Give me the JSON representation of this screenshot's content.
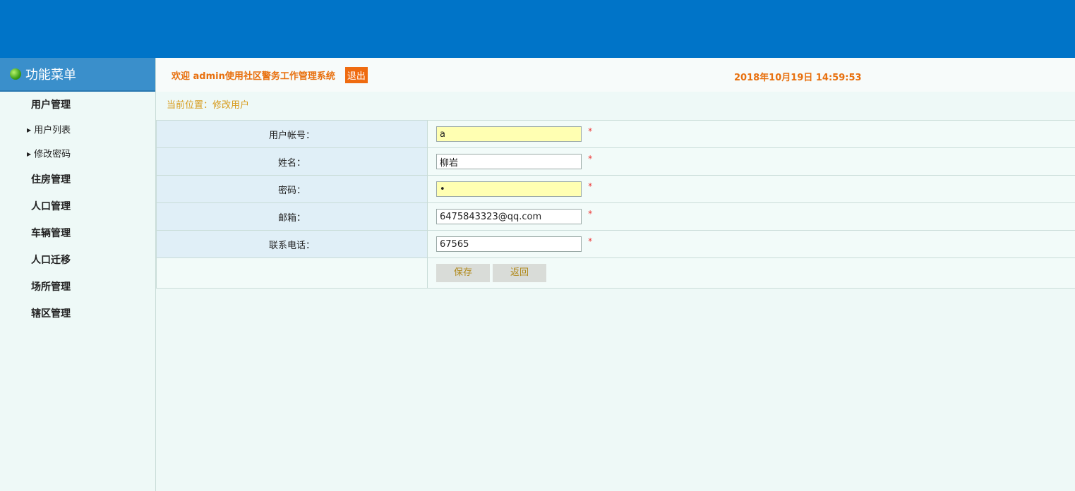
{
  "sidebar": {
    "title": "功能菜单",
    "items": [
      {
        "label": "用户管理",
        "type": "group"
      },
      {
        "label": "用户列表",
        "type": "sub"
      },
      {
        "label": "修改密码",
        "type": "sub"
      },
      {
        "label": "住房管理",
        "type": "group"
      },
      {
        "label": "人口管理",
        "type": "group"
      },
      {
        "label": "车辆管理",
        "type": "group"
      },
      {
        "label": "人口迁移",
        "type": "group"
      },
      {
        "label": "场所管理",
        "type": "group"
      },
      {
        "label": "辖区管理",
        "type": "group"
      }
    ]
  },
  "header": {
    "welcome": "欢迎 admin使用社区警务工作管理系统",
    "logout_label": "退出",
    "datetime": "2018年10月19日 14:59:53"
  },
  "breadcrumb": "当前位置：修改用户",
  "form": {
    "fields": [
      {
        "label": "用户帐号：",
        "value": "a",
        "required_mark": "*"
      },
      {
        "label": "姓名：",
        "value": "柳岩",
        "required_mark": "*"
      },
      {
        "label": "密码：",
        "value": "•",
        "required_mark": "*"
      },
      {
        "label": "邮箱：",
        "value": "6475843323@qq.com",
        "required_mark": "*"
      },
      {
        "label": "联系电话：",
        "value": "67565",
        "required_mark": "*"
      }
    ],
    "save_label": "保存",
    "back_label": "返回"
  },
  "colors": {
    "banner": "#0074c8",
    "sidebar_header": "#3a8fcb",
    "accent_orange": "#e8700e",
    "highlight_input": "#ffffb2"
  }
}
